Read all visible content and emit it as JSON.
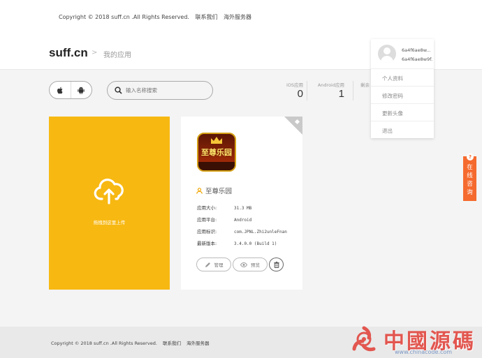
{
  "top_links": {
    "copyright": "Copyright © 2018 suff.cn .All Rights Reserved.",
    "contact": "联系我们",
    "overseas": "海外服务器"
  },
  "header": {
    "logo": "suff.cn",
    "breadcrumb_sep": ">",
    "breadcrumb": "我的应用"
  },
  "user_menu": {
    "user_id_line1": "6a4f6ae8w...",
    "user_id_line2": "6a4f6ae8w9f...",
    "items": [
      "个人资料",
      "修改密码",
      "更新头像",
      "退出"
    ]
  },
  "toolbar": {
    "search_placeholder": "输入名称搜索",
    "ios_label": "iOS应用",
    "ios_count": "0",
    "android_label": "Android应用",
    "android_count": "1",
    "third_label": "剩余"
  },
  "upload": {
    "text": "拖拽到这里上传"
  },
  "app_card": {
    "icon_text": "至尊乐园",
    "name": "至尊乐园",
    "size_label": "应用大小:",
    "size_value": "31.3 MB",
    "platform_label": "应用平台:",
    "platform_value": "Android",
    "id_label": "应用标识:",
    "id_value": "com.JPNL.Zhi2unleFnan",
    "version_label": "最新版本:",
    "version_value": "3.4.0.0 (Build 1)",
    "manage_label": "管理",
    "preview_label": "预览"
  },
  "side_widget": {
    "q": "?",
    "lines": [
      "在",
      "线",
      "咨",
      "询"
    ]
  },
  "footer": {
    "copyright": "Copyright © 2018 suff.cn .All Rights Reserved.",
    "contact": "联系我们",
    "overseas": "海外服务器"
  },
  "watermark": {
    "text": "中國源碼",
    "url": "www.chinacode.com"
  },
  "colors": {
    "upload_bg": "#f7b812",
    "consult_bg": "#f56a2e",
    "watermark_red": "#e2564f"
  }
}
